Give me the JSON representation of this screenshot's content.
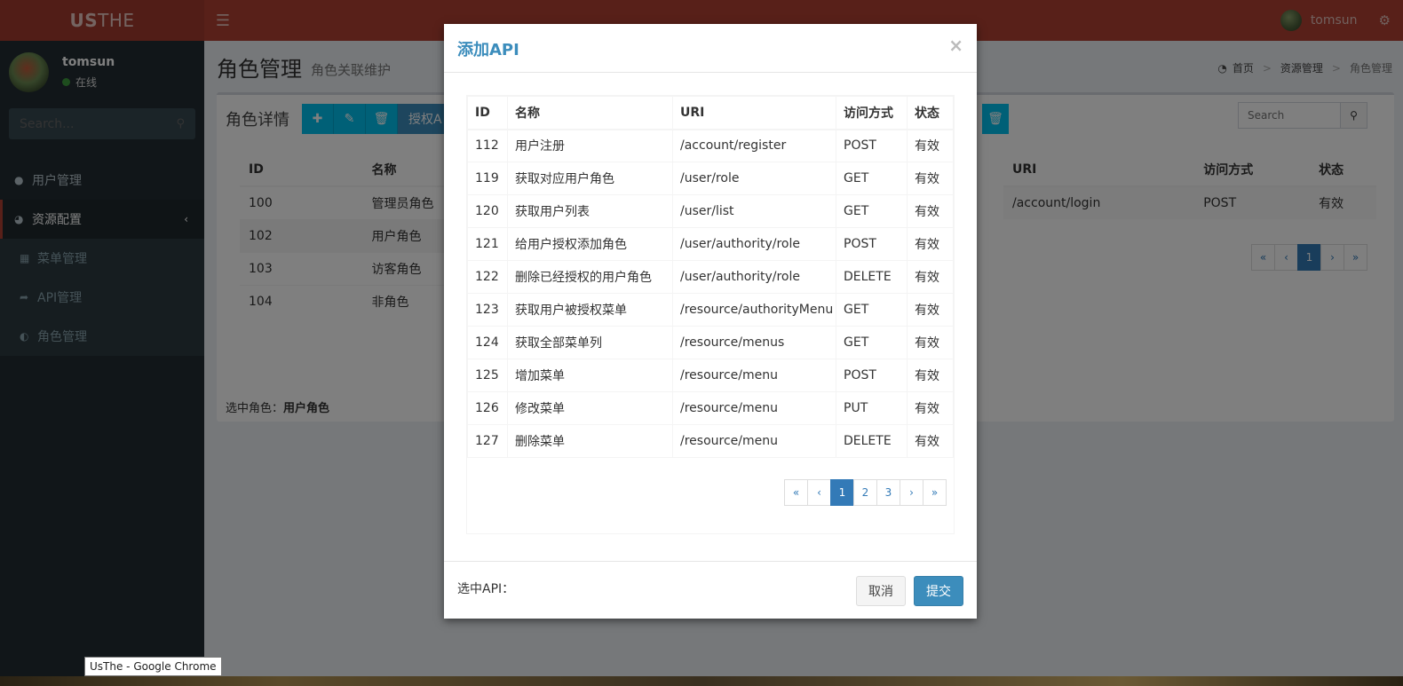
{
  "app": {
    "logo_bold": "US",
    "logo_thin": "THE",
    "user_name": "tomsun"
  },
  "sidebar": {
    "user_name": "tomsun",
    "status": "在线",
    "search_placeholder": "Search...",
    "items": [
      {
        "label": "用户管理",
        "icon": "user-icon"
      },
      {
        "label": "资源配置",
        "icon": "pie-chart-icon"
      },
      {
        "label": "菜单管理",
        "icon": "grid-icon"
      },
      {
        "label": "API管理",
        "icon": "share-icon"
      },
      {
        "label": "角色管理",
        "icon": "adjust-icon"
      }
    ]
  },
  "page": {
    "title": "角色管理",
    "subtitle": "角色关联维护",
    "breadcrumb": [
      "首页",
      "资源管理",
      "角色管理"
    ]
  },
  "box": {
    "title": "角色详情",
    "authorize_label": "授权A",
    "search_placeholder": "Search",
    "role_headers": [
      "ID",
      "名称"
    ],
    "roles": [
      {
        "id": "100",
        "name": "管理员角色"
      },
      {
        "id": "102",
        "name": "用户角色"
      },
      {
        "id": "103",
        "name": "访客角色"
      },
      {
        "id": "104",
        "name": "非角色"
      }
    ],
    "api_headers": [
      "URI",
      "访问方式",
      "状态"
    ],
    "api_row": {
      "uri": "/account/login",
      "method": "POST",
      "status": "有效"
    },
    "pager": [
      "«",
      "‹",
      "1",
      "›",
      "»"
    ],
    "footer_label": "选中角色：",
    "footer_value": "用户角色"
  },
  "modal": {
    "title": "添加API",
    "close": "×",
    "headers": [
      "ID",
      "名称",
      "URI",
      "访问方式",
      "状态"
    ],
    "rows": [
      {
        "id": "112",
        "name": "用户注册",
        "uri": "/account/register",
        "method": "POST",
        "status": "有效"
      },
      {
        "id": "119",
        "name": "获取对应用户角色",
        "uri": "/user/role",
        "method": "GET",
        "status": "有效"
      },
      {
        "id": "120",
        "name": "获取用户列表",
        "uri": "/user/list",
        "method": "GET",
        "status": "有效"
      },
      {
        "id": "121",
        "name": "给用户授权添加角色",
        "uri": "/user/authority/role",
        "method": "POST",
        "status": "有效"
      },
      {
        "id": "122",
        "name": "删除已经授权的用户角色",
        "uri": "/user/authority/role",
        "method": "DELETE",
        "status": "有效"
      },
      {
        "id": "123",
        "name": "获取用户被授权菜单",
        "uri": "/resource/authorityMenu",
        "method": "GET",
        "status": "有效"
      },
      {
        "id": "124",
        "name": "获取全部菜单列",
        "uri": "/resource/menus",
        "method": "GET",
        "status": "有效"
      },
      {
        "id": "125",
        "name": "增加菜单",
        "uri": "/resource/menu",
        "method": "POST",
        "status": "有效"
      },
      {
        "id": "126",
        "name": "修改菜单",
        "uri": "/resource/menu",
        "method": "PUT",
        "status": "有效"
      },
      {
        "id": "127",
        "name": "删除菜单",
        "uri": "/resource/menu",
        "method": "DELETE",
        "status": "有效"
      }
    ],
    "pager": [
      "«",
      "‹",
      "1",
      "2",
      "3",
      "›",
      "»"
    ],
    "current_page": "1",
    "footer_label": "选中API：",
    "cancel_label": "取消",
    "submit_label": "提交"
  },
  "tooltip": "UsThe - Google Chrome",
  "colors": {
    "header": "#b04032",
    "sidebar": "#222d32",
    "primary": "#3c8dbc",
    "info": "#00c0ef"
  }
}
